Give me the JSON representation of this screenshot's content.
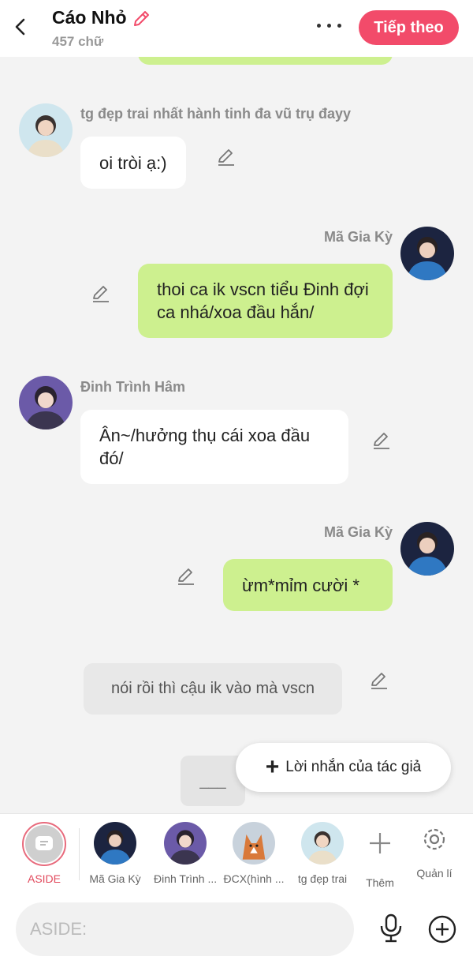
{
  "header": {
    "title": "Cáo Nhỏ",
    "word_count": "457 chữ",
    "next_label": "Tiếp theo",
    "accent": "#f24b6a"
  },
  "messages": [
    {
      "side": "left",
      "name": "tg đẹp trai nhất hành tinh đa vũ trụ đayy",
      "text": "oi tròi ạ:)"
    },
    {
      "side": "right",
      "name": "Mã Gia Kỳ",
      "text": "thoi ca ik vscn tiểu Đinh đợi ca nhá/xoa đầu hắn/"
    },
    {
      "side": "left",
      "name": "Đinh Trình Hâm",
      "text": "Ân~/hưởng thụ cái xoa đầu đó/"
    },
    {
      "side": "right",
      "name": "Mã Gia Kỳ",
      "text": "ừm*mỉm cười *"
    }
  ],
  "narration": "nói rồi thì cậu ik vào mà vscn",
  "typing_placeholder": "___",
  "author_note": {
    "icon": "plus-icon",
    "label": "Lời nhắn của tác giả"
  },
  "charbar": {
    "aside_label": "ASIDE",
    "characters": [
      {
        "label": "Mã Gia Kỳ"
      },
      {
        "label": "Đinh Trình ..."
      },
      {
        "label": "ĐCX(hình ..."
      },
      {
        "label": "tg đẹp trai"
      }
    ],
    "add_label": "Thêm",
    "manage_label": "Quản lí"
  },
  "input": {
    "placeholder": "ASIDE:"
  },
  "colors": {
    "green_bubble": "#cdf08f",
    "white_bubble": "#ffffff",
    "aside_ring": "#e86a7c"
  }
}
